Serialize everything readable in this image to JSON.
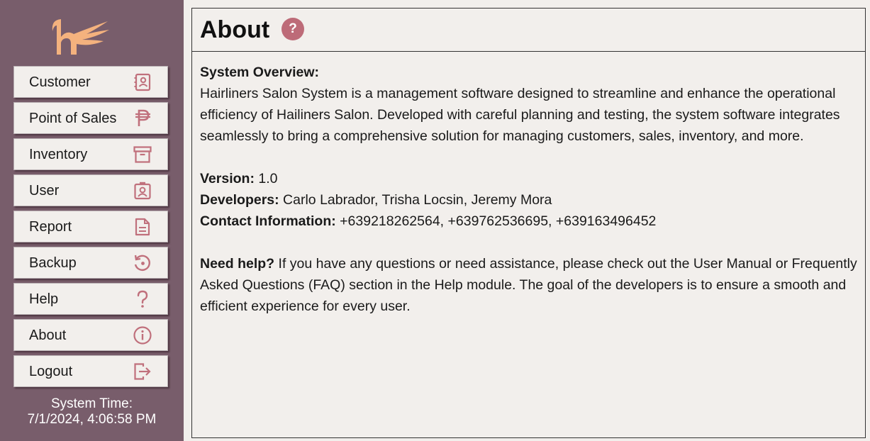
{
  "sidebar": {
    "logo": "hairliners-logo",
    "items": [
      {
        "label": "Customer",
        "icon": "address-book-icon"
      },
      {
        "label": "Point of Sales",
        "icon": "peso-icon"
      },
      {
        "label": "Inventory",
        "icon": "archive-box-icon"
      },
      {
        "label": "User",
        "icon": "user-badge-icon"
      },
      {
        "label": "Report",
        "icon": "document-icon"
      },
      {
        "label": "Backup",
        "icon": "restore-icon"
      },
      {
        "label": "Help",
        "icon": "question-icon"
      },
      {
        "label": "About",
        "icon": "info-icon"
      },
      {
        "label": "Logout",
        "icon": "logout-icon"
      }
    ],
    "system_time_label": "System Time:",
    "system_time_value": "7/1/2024, 4:06:58 PM"
  },
  "main": {
    "title": "About",
    "help_badge": "?",
    "overview_heading": "System Overview:",
    "overview_text": "Hairliners Salon System is a management software designed to streamline and enhance the operational efficiency of Hailiners Salon. Developed with careful planning and testing, the system software integrates seamlessly to bring a comprehensive solution for managing customers, sales, inventory, and more.",
    "version_label": "Version:",
    "version_value": " 1.0",
    "developers_label": "Developers:",
    "developers_value": " Carlo Labrador, Trisha Locsin, Jeremy Mora",
    "contact_label": "Contact Information:",
    "contact_value": " +639218262564, +639762536695, +639163496452",
    "help_label": "Need help?",
    "help_text": " If you have any questions or need assistance, please check out the User Manual or Frequently Asked Questions (FAQ) section in the Help module. The goal of the developers is to ensure a smooth and efficient experience for every user."
  },
  "colors": {
    "sidebar_bg": "#785d6b",
    "accent_icon": "#c0707c",
    "logo": "#f4b27e",
    "background": "#f2efec"
  }
}
